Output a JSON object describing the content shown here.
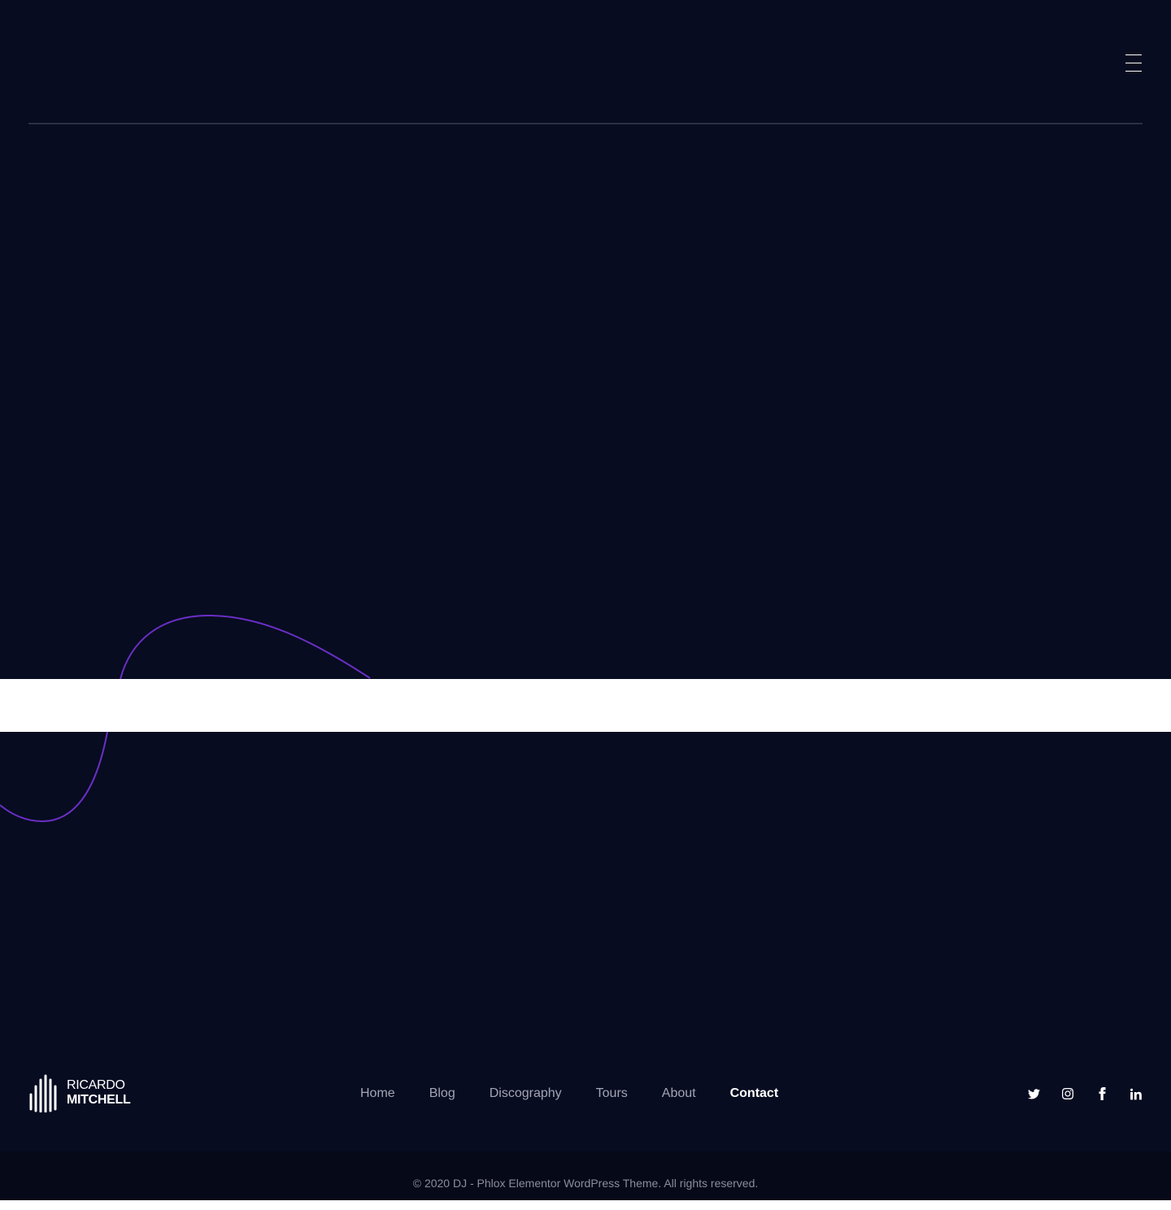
{
  "colors": {
    "background": "#070c21",
    "accent_curve": "#6a2fc4",
    "header_rule": "#2b3042",
    "nav_text": "#a3a5b3",
    "nav_active": "#ffffff",
    "copyright_bar": "#050918"
  },
  "header": {
    "menu_icon": "hamburger-icon"
  },
  "footer": {
    "logo": {
      "line1": "RICARDO",
      "line2": "MITCHELL"
    },
    "nav": [
      {
        "label": "Home"
      },
      {
        "label": "Blog"
      },
      {
        "label": "Discography"
      },
      {
        "label": "Tours"
      },
      {
        "label": "About"
      },
      {
        "label": "Contact",
        "active": true
      }
    ],
    "socials": [
      {
        "icon": "twitter-icon"
      },
      {
        "icon": "instagram-icon"
      },
      {
        "icon": "facebook-icon"
      },
      {
        "icon": "linkedin-icon"
      }
    ],
    "copyright": "© 2020 DJ - Phlox Elementor WordPress Theme. All rights reserved."
  }
}
